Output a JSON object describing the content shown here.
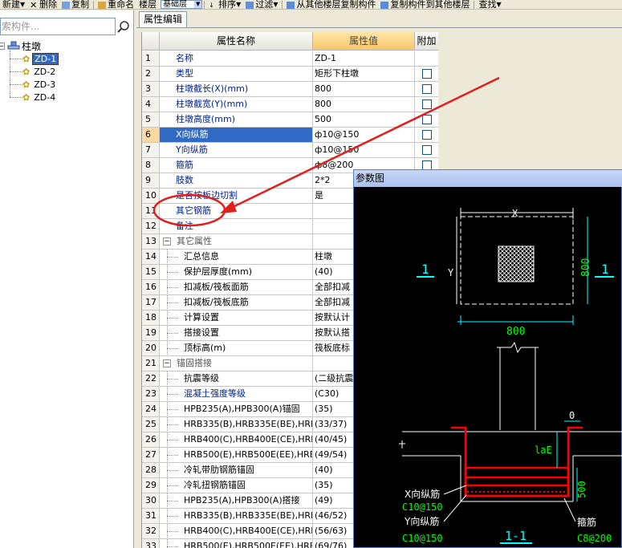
{
  "toolbar": {
    "new": "新建",
    "delete": "删除",
    "copy": "复制",
    "rename": "重命名",
    "floor_label": "楼层",
    "floor_value": "基础层",
    "sort": "排序",
    "filter": "过滤",
    "copy_from_floor": "从其他楼层复制构件",
    "copy_to_floor": "复制构件到其他楼层",
    "find": "查找"
  },
  "search": {
    "placeholder": "索构件..."
  },
  "tree": {
    "root": "柱墩",
    "items": [
      "ZD-1",
      "ZD-2",
      "ZD-3",
      "ZD-4"
    ]
  },
  "tabs": {
    "properties": "属性编辑"
  },
  "grid": {
    "headers": {
      "name": "属性名称",
      "value": "属性值",
      "extra": "附加"
    },
    "rows": [
      {
        "num": "1",
        "name": "名称",
        "value": "ZD-1",
        "check": false
      },
      {
        "num": "2",
        "name": "类型",
        "value": "矩形下柱墩",
        "check": true
      },
      {
        "num": "3",
        "name": "柱墩截长(X)(mm)",
        "value": "800",
        "check": true
      },
      {
        "num": "4",
        "name": "柱墩截宽(Y)(mm)",
        "value": "800",
        "check": true
      },
      {
        "num": "5",
        "name": "柱墩高度(mm)",
        "value": "500",
        "check": true
      },
      {
        "num": "6",
        "name": "X向纵筋",
        "value": "ф10@150",
        "check": true
      },
      {
        "num": "7",
        "name": "Y向纵筋",
        "value": "ф10@150",
        "check": true
      },
      {
        "num": "8",
        "name": "箍筋",
        "value": "ф8@200",
        "check": true
      },
      {
        "num": "9",
        "name": "肢数",
        "value": "2*2",
        "check": false
      },
      {
        "num": "10",
        "name": "是否按板边切割",
        "value": "是",
        "check": false
      },
      {
        "num": "11",
        "name": "其它钢筋",
        "value": "",
        "check": false
      },
      {
        "num": "12",
        "name": "备注",
        "value": "",
        "check": false
      },
      {
        "num": "13",
        "name": "其它属性",
        "value": "",
        "check": false
      },
      {
        "num": "14",
        "name": "汇总信息",
        "value": "柱墩",
        "check": false
      },
      {
        "num": "15",
        "name": "保护层厚度(mm)",
        "value": "(40)",
        "check": false
      },
      {
        "num": "16",
        "name": "扣减板/筏板面筋",
        "value": "全部扣减",
        "check": false
      },
      {
        "num": "17",
        "name": "扣减板/筏板底筋",
        "value": "全部扣减",
        "check": false
      },
      {
        "num": "18",
        "name": "计算设置",
        "value": "按默认计",
        "check": false
      },
      {
        "num": "19",
        "name": "搭接设置",
        "value": "按默认搭",
        "check": false
      },
      {
        "num": "20",
        "name": "顶标高(m)",
        "value": "筏板底标",
        "check": false
      },
      {
        "num": "21",
        "name": "锚固搭接",
        "value": "",
        "check": false
      },
      {
        "num": "22",
        "name": "抗震等级",
        "value": "(二级抗震",
        "check": false
      },
      {
        "num": "23",
        "name": "混凝土强度等级",
        "value": "(C30)",
        "check": false
      },
      {
        "num": "24",
        "name": "HPB235(A),HPB300(A)锚固",
        "value": "(35)",
        "check": false
      },
      {
        "num": "25",
        "name": "HRB335(B),HRB335E(BE),HRBF",
        "value": "(33/37)",
        "check": false
      },
      {
        "num": "26",
        "name": "HRB400(C),HRB400E(CE),HRBF",
        "value": "(40/45)",
        "check": false
      },
      {
        "num": "27",
        "name": "HRB500(E),HRB500E(EE),HRBF",
        "value": "(49/54)",
        "check": false
      },
      {
        "num": "28",
        "name": "冷轧带肋钢筋锚固",
        "value": "(40)",
        "check": false
      },
      {
        "num": "29",
        "name": "冷轧扭钢筋锚固",
        "value": "(35)",
        "check": false
      },
      {
        "num": "30",
        "name": "HPB235(A),HPB300(A)搭接",
        "value": "(49)",
        "check": false
      },
      {
        "num": "31",
        "name": "HRB335(B),HRB335E(BE),HRBF",
        "value": "(46/52)",
        "check": false
      },
      {
        "num": "32",
        "name": "HRB400(C),HRB400E(CE),HRBF",
        "value": "(56/63)",
        "check": false
      },
      {
        "num": "33",
        "name": "HRB500(E),HRB500E(EE),HRBF",
        "value": "(69/76)",
        "check": false
      }
    ]
  },
  "diagram": {
    "title": "参数图",
    "dim_x": "X",
    "dim_y": "Y",
    "dim_800_h": "800",
    "dim_800_v": "800",
    "section_mark": "1",
    "dim_zero": "0",
    "lae": "laE",
    "dim_500": "500",
    "x_rebar": "X向纵筋",
    "x_rebar_val": "C10@150",
    "y_rebar": "Y向纵筋",
    "y_rebar_val": "C10@150",
    "stirrup": "箍筋",
    "stirrup_val": "C8@200",
    "section_label": "1-1"
  },
  "colors": {
    "selection": "#316ac5",
    "header_value": "#f8c66a",
    "annotation": "#e0201c",
    "cad_cyan": "#00ffff",
    "cad_green": "#00ff00",
    "cad_red": "#ff0000"
  }
}
